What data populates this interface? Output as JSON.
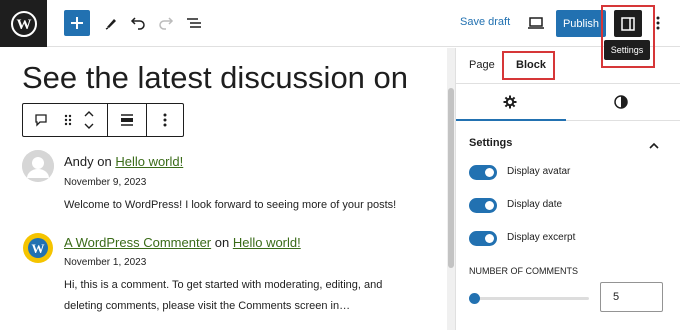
{
  "toolbar": {
    "save_draft": "Save draft",
    "publish": "Publish",
    "tooltip": "Settings"
  },
  "canvas": {
    "heading": "See the latest discussion on"
  },
  "comments": [
    {
      "author": "Andy",
      "on": " on ",
      "post": "Hello world!",
      "date": "November 9, 2023",
      "text": "Welcome to WordPress! I look forward to seeing more of your posts!"
    },
    {
      "author": "A WordPress Commenter",
      "on": " on ",
      "post": "Hello world!",
      "date": "November 1, 2023",
      "text_line1": "Hi, this is a comment. To get started with moderating, editing, and",
      "text_line2": "deleting comments, please visit the Comments screen in…"
    }
  ],
  "sidebar": {
    "tab_page": "Page",
    "tab_block": "Block",
    "panel_title": "Settings",
    "toggles": [
      {
        "label": "Display avatar",
        "on": true
      },
      {
        "label": "Display date",
        "on": true
      },
      {
        "label": "Display excerpt",
        "on": true
      }
    ],
    "number_label": "Number of comments",
    "number_value": "5",
    "range_fraction": 0.0
  },
  "colors": {
    "accent": "#2271b1",
    "highlight": "#d63638",
    "link": "#3a6b18"
  }
}
